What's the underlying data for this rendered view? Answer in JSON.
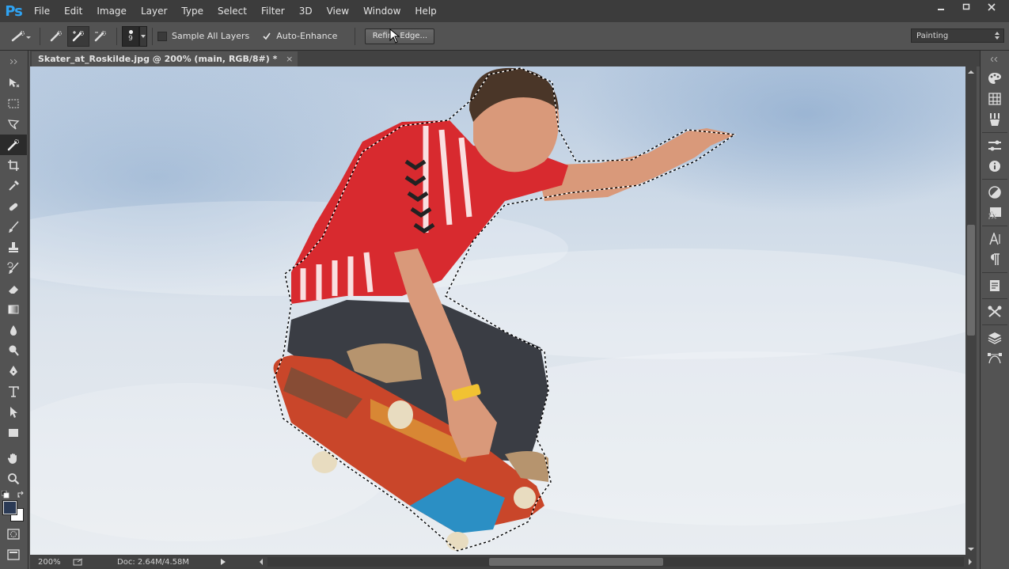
{
  "app": {
    "logo": "Ps"
  },
  "menu": [
    "File",
    "Edit",
    "Image",
    "Layer",
    "Type",
    "Select",
    "Filter",
    "3D",
    "View",
    "Window",
    "Help"
  ],
  "window_controls": [
    "minimize-icon",
    "restore-icon",
    "close-icon"
  ],
  "options": {
    "brush_size": "9",
    "sample_all_layers": {
      "label": "Sample All Layers",
      "checked": false
    },
    "auto_enhance": {
      "label": "Auto-Enhance",
      "checked": true
    },
    "refine_edge_label": "Refine Edge...",
    "workspace": "Painting"
  },
  "document": {
    "tab_title": "Skater_at_Roskilde.jpg @ 200% (main, RGB/8#) *",
    "close_glyph": "×"
  },
  "status": {
    "zoom": "200%",
    "doc_info": "Doc: 2.64M/4.58M"
  },
  "tools": [
    "move-icon",
    "marquee-icon",
    "lasso-icon",
    "quick-selection-icon",
    "crop-icon",
    "eyedropper-icon",
    "healing-brush-icon",
    "brush-icon",
    "clone-stamp-icon",
    "history-brush-icon",
    "eraser-icon",
    "gradient-icon",
    "blur-icon",
    "dodge-icon",
    "pen-icon",
    "type-icon",
    "path-selection-icon",
    "rectangle-icon",
    "hand-icon",
    "zoom-icon"
  ],
  "colors": {
    "foreground": "#2b3a55",
    "background": "#ffffff",
    "accent": "#2fa3f3"
  },
  "panels": [
    "color-panel-icon",
    "swatches-icon",
    "brushes-icon",
    "adjustments-icon",
    "info-icon",
    "styles-icon",
    "fx-icon",
    "character-icon",
    "paragraph-icon",
    "notes-icon",
    "tools-presets-icon",
    "layers-icon",
    "paths-icon"
  ]
}
